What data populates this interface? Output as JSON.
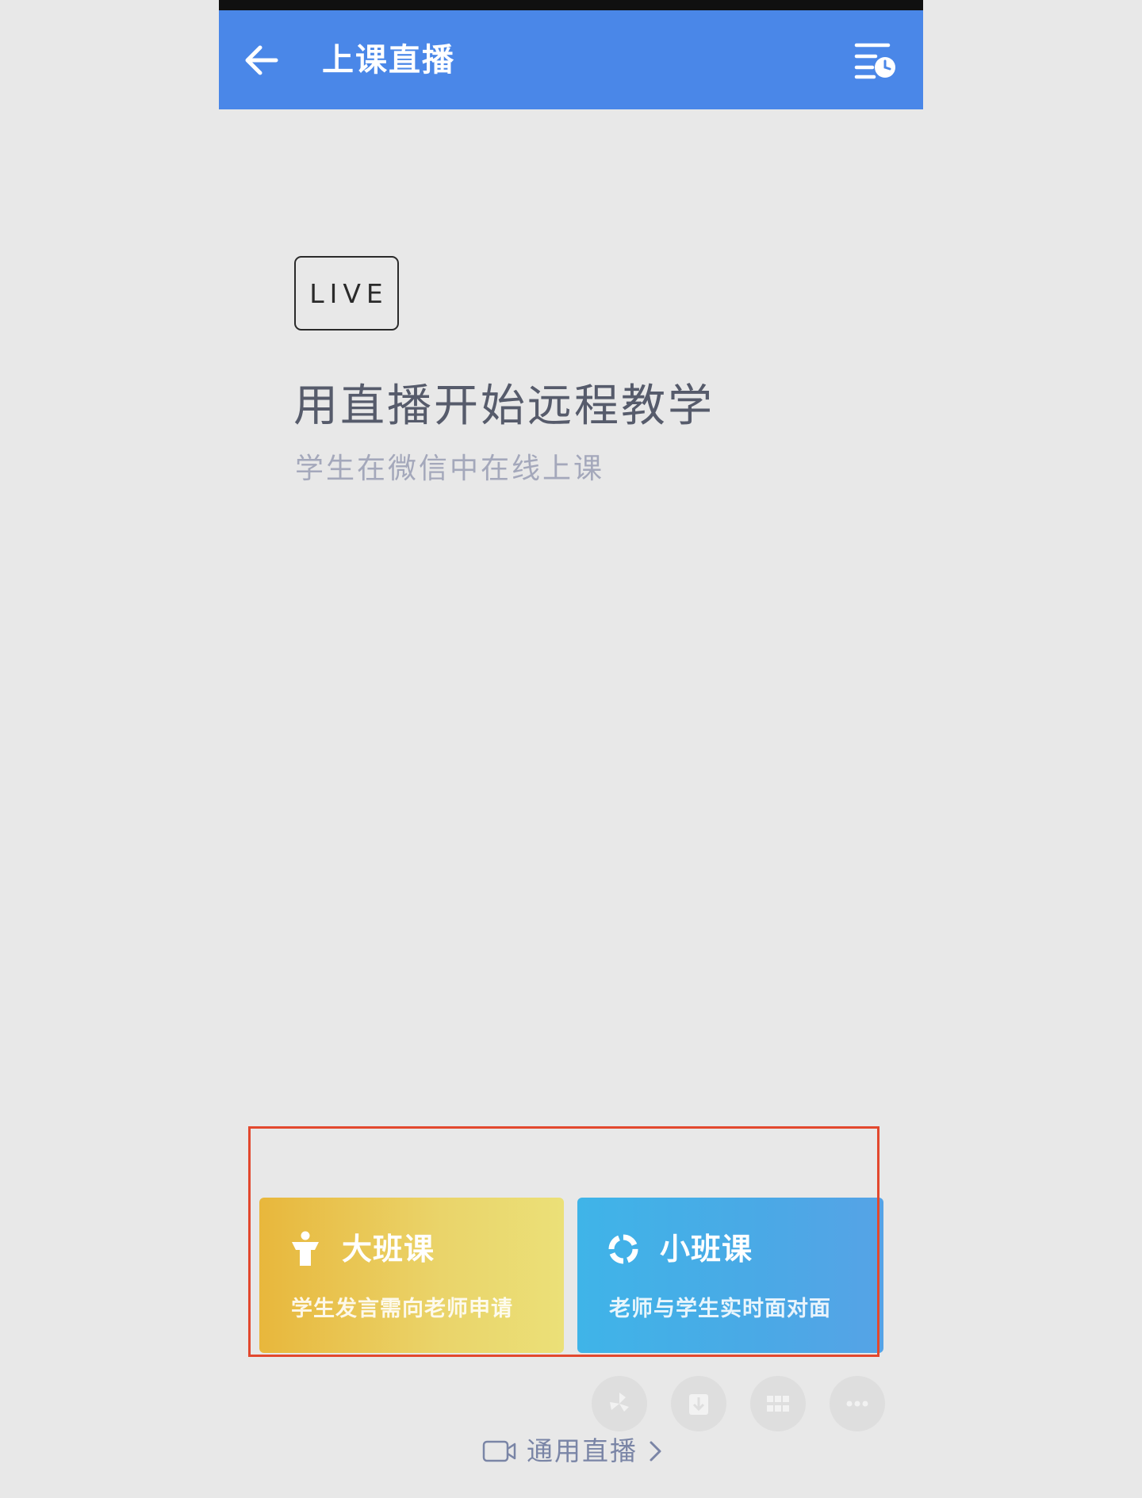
{
  "header": {
    "title": "上课直播",
    "back_icon": "back-arrow-icon",
    "history_icon": "schedule-list-icon",
    "background_color": "#4a87e8"
  },
  "hero": {
    "badge": "LIVE",
    "headline": "用直播开始远程教学",
    "subline": "学生在微信中在线上课"
  },
  "options": [
    {
      "title": "大班课",
      "description": "学生发言需向老师申请",
      "icon": "lecturer-icon",
      "color": "#e8b73c"
    },
    {
      "title": "小班课",
      "description": "老师与学生实时面对面",
      "icon": "ring-icon",
      "color": "#3fb4e8"
    }
  ],
  "footer": {
    "general_live_label": "通用直播",
    "general_live_icon": "video-camera-icon",
    "chevron_icon": "chevron-right-icon"
  },
  "floating_buttons": [
    {
      "icon": "pinwheel-icon"
    },
    {
      "icon": "download-icon"
    },
    {
      "icon": "grid-icon"
    },
    {
      "icon": "more-icon"
    }
  ],
  "annotation": {
    "highlight_color": "#e2482e"
  }
}
